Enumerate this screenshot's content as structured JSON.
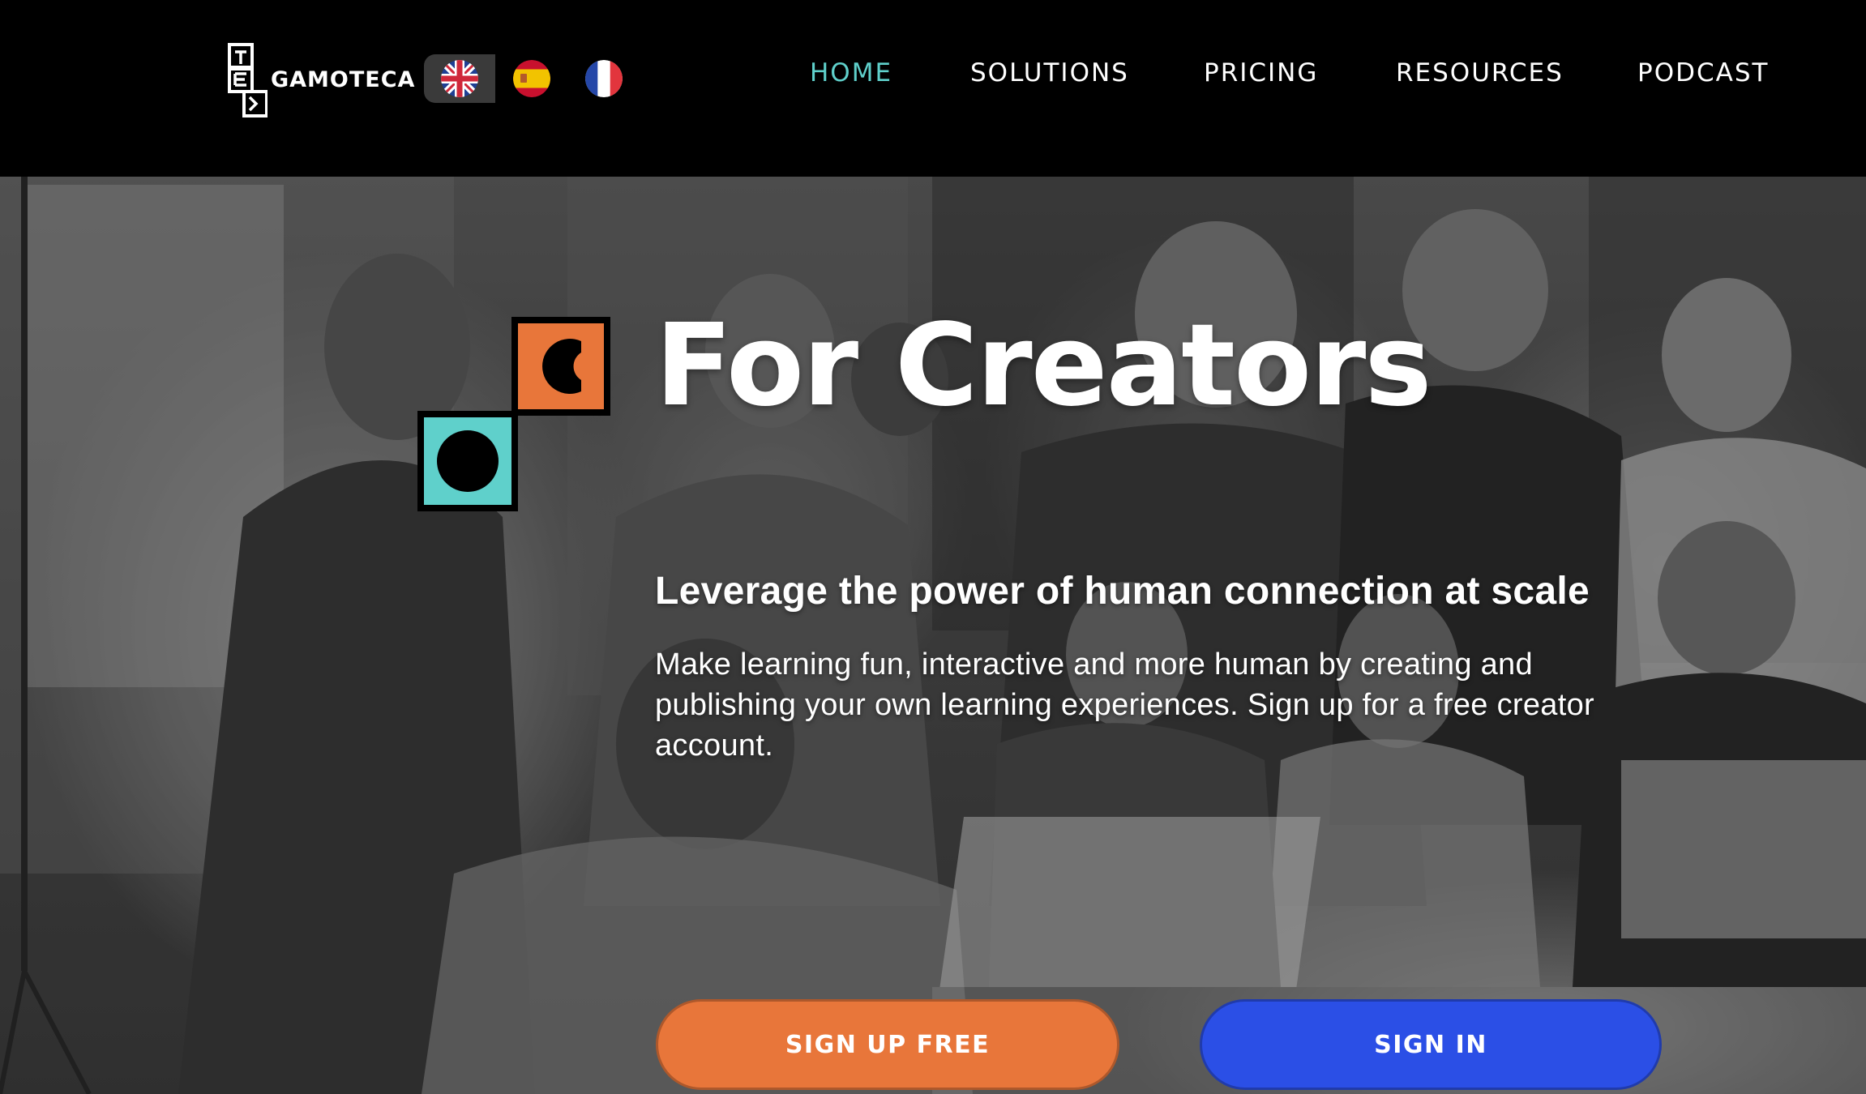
{
  "brand": {
    "name": "GAMOTECA"
  },
  "languages": [
    {
      "code": "en",
      "icon": "uk-flag-icon",
      "active": true
    },
    {
      "code": "es",
      "icon": "spain-flag-icon",
      "active": false
    },
    {
      "code": "fr",
      "icon": "france-flag-icon",
      "active": false
    }
  ],
  "nav": {
    "items": [
      {
        "label": "HOME",
        "active": true
      },
      {
        "label": "SOLUTIONS",
        "active": false
      },
      {
        "label": "PRICING",
        "active": false
      },
      {
        "label": "RESOURCES",
        "active": false
      },
      {
        "label": "PODCAST",
        "active": false
      }
    ]
  },
  "hero": {
    "title": "For Creators",
    "subtitle": "Leverage the power of human connection at scale",
    "body": "Make learning fun, interactive and more human by creating and publishing your own learning experiences. Sign up for a free creator account.",
    "primary_button": "SIGN UP FREE",
    "secondary_button": "SIGN IN"
  },
  "colors": {
    "nav_active": "#5fd0cb",
    "signup_button": "#e8763a",
    "signin_button": "#2b4fe6",
    "logo_orange": "#e8763a",
    "logo_teal": "#5fd0cb"
  }
}
